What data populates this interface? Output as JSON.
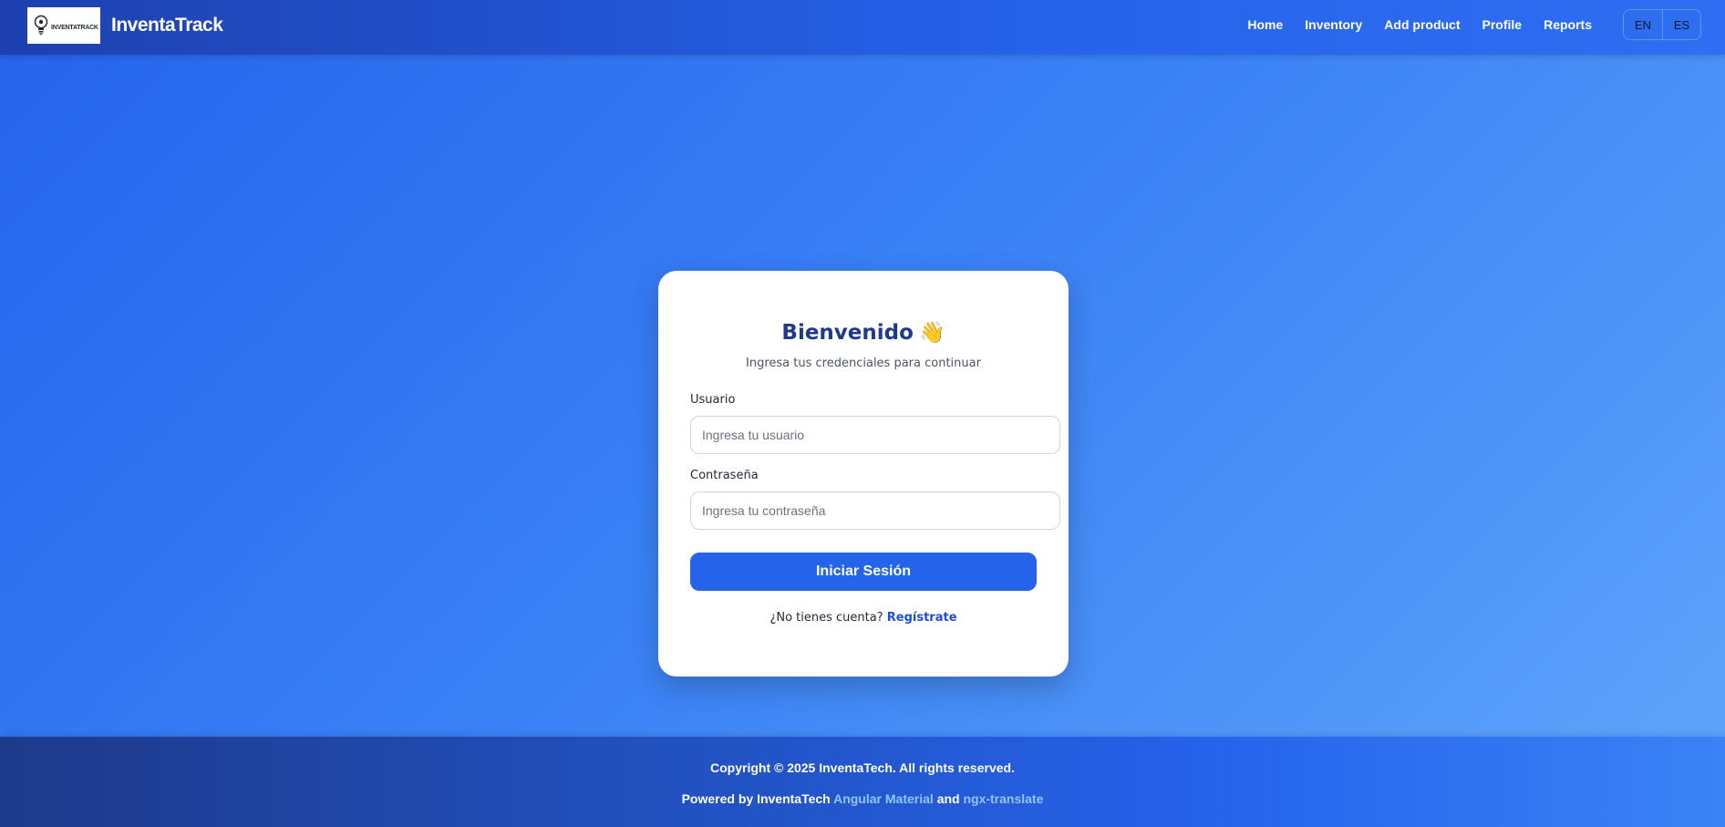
{
  "header": {
    "logo_text": "INVENTATRACK",
    "brand": "InventaTrack",
    "nav": [
      "Home",
      "Inventory",
      "Add product",
      "Profile",
      "Reports"
    ],
    "languages": [
      "EN",
      "ES"
    ]
  },
  "login": {
    "title": "Bienvenido",
    "wave_emoji": "👋",
    "subtitle": "Ingresa tus credenciales para continuar",
    "username_label": "Usuario",
    "username_placeholder": "Ingresa tu usuario",
    "password_label": "Contraseña",
    "password_placeholder": "Ingresa tu contraseña",
    "submit_label": "Iniciar Sesión",
    "signup_prompt": "¿No tienes cuenta?",
    "signup_link": "Regístrate"
  },
  "footer": {
    "copyright": "Copyright © 2025 InventaTech. All rights reserved.",
    "powered_prefix": "Powered by InventaTech",
    "powered_link1": "Angular Material",
    "powered_and": "and",
    "powered_link2": "ngx-translate"
  },
  "colors": {
    "primary": "#2563eb",
    "title": "#1e3a8a",
    "link": "#1d4ed8",
    "footer_link": "#93c5fd"
  },
  "icons": [
    "lightbulb-logo-icon",
    "waving-hand-icon"
  ]
}
